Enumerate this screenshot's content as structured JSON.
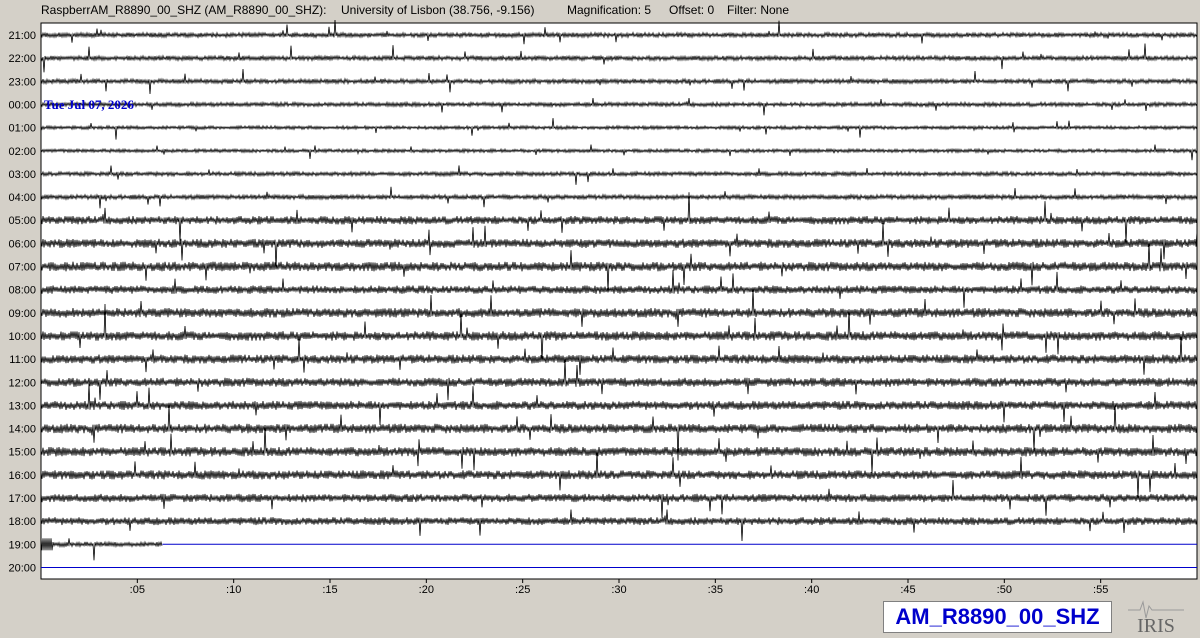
{
  "header": {
    "station": "RaspberrAM_R8890_00_SHZ (AM_R8890_00_SHZ):",
    "location": "University of Lisbon (38.756, -9.156)",
    "magnification": "Magnification: 5",
    "offset": "Offset: 0",
    "filter": "Filter: None"
  },
  "helicorder": {
    "date_label": "Tue Jul 07, 2026",
    "hours": [
      "21:00",
      "22:00",
      "23:00",
      "00:00",
      "01:00",
      "02:00",
      "03:00",
      "04:00",
      "05:00",
      "06:00",
      "07:00",
      "08:00",
      "09:00",
      "10:00",
      "11:00",
      "12:00",
      "13:00",
      "14:00",
      "15:00",
      "16:00",
      "17:00",
      "18:00",
      "19:00",
      "20:00"
    ],
    "x_ticks": [
      ":05",
      ":10",
      ":15",
      ":20",
      ":25",
      ":30",
      ":35",
      ":40",
      ":45",
      ":50",
      ":55"
    ],
    "row_noise": [
      2,
      2,
      2,
      1.8,
      1.5,
      1.5,
      1.8,
      2,
      3.5,
      3.8,
      4,
      3.5,
      4,
      4,
      3.8,
      3.8,
      3.8,
      4,
      4,
      3.8,
      3.5,
      3.3,
      2,
      0
    ],
    "last_partial_row_minutes": 6.3,
    "trace_color": "#000000",
    "empty_line_color": "#0000cc"
  },
  "footer": {
    "station_code": "AM_R8890_00_SHZ",
    "logo_text": "IRIS"
  }
}
